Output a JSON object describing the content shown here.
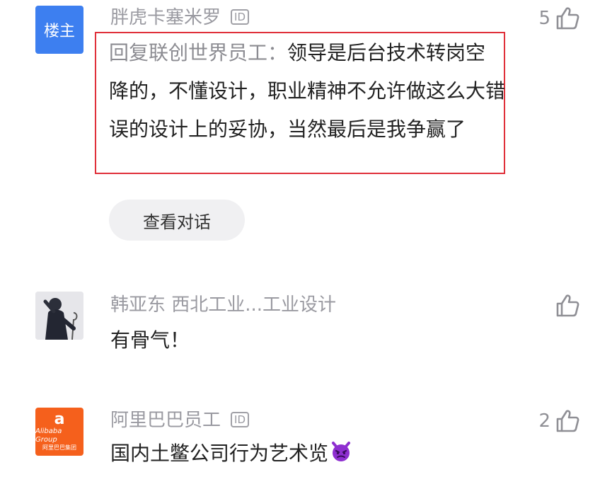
{
  "comments": [
    {
      "avatar_text": "楼主",
      "username": "胖虎卡塞米罗",
      "id_badge": "ID",
      "likes": "5",
      "reply_prefix": "回复联创世界员工：",
      "reply_body": "领导是后台技术转岗空降的，不懂设计，职业精神不允许做这么大错误的设计上的妥协，当然最后是我争赢了",
      "view_conversation": "查看对话"
    },
    {
      "username": "韩亚东 西北工业...工业设计",
      "text": "有骨气！",
      "likes": ""
    },
    {
      "avatar_mark": "a",
      "avatar_en": "Alibaba Group",
      "avatar_cn": "阿里巴巴集团",
      "username": "阿里巴巴员工",
      "id_badge": "ID",
      "likes": "2",
      "text": "国内土鳖公司行为艺术览",
      "emoji": "devil-face-emoji"
    }
  ],
  "colors": {
    "host_avatar": "#3d7ff0",
    "alibaba_avatar": "#f5601c",
    "highlight_border": "#e0303a",
    "username": "#9a9aa1"
  }
}
